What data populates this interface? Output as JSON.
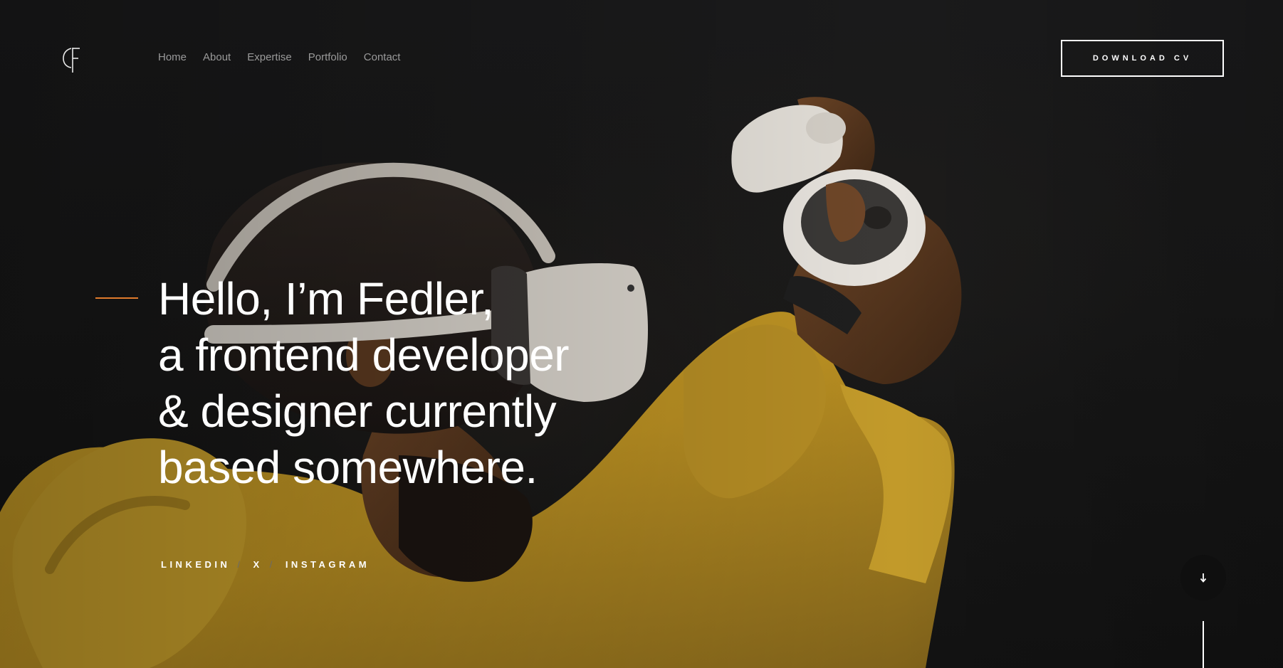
{
  "header": {
    "logo_alt": "FC monogram logo",
    "nav": [
      {
        "label": "Home"
      },
      {
        "label": "About"
      },
      {
        "label": "Expertise"
      },
      {
        "label": "Portfolio"
      },
      {
        "label": "Contact"
      }
    ],
    "cta_label": "DOWNLOAD CV"
  },
  "intro": {
    "lines": [
      "Hello, I’m Fedler,",
      "a frontend developer",
      "& designer currently",
      "based somewhere."
    ]
  },
  "social": {
    "links": [
      "LINKEDIN",
      "X",
      "INSTAGRAM"
    ],
    "separator": "/"
  },
  "scroll": {
    "icon": "arrow-down-icon"
  },
  "colors": {
    "background": "#141414",
    "accent": "#e07b2c",
    "text": "#ffffff",
    "nav_text": "#9a9a9a",
    "hoodie": "#d4ab2c"
  }
}
